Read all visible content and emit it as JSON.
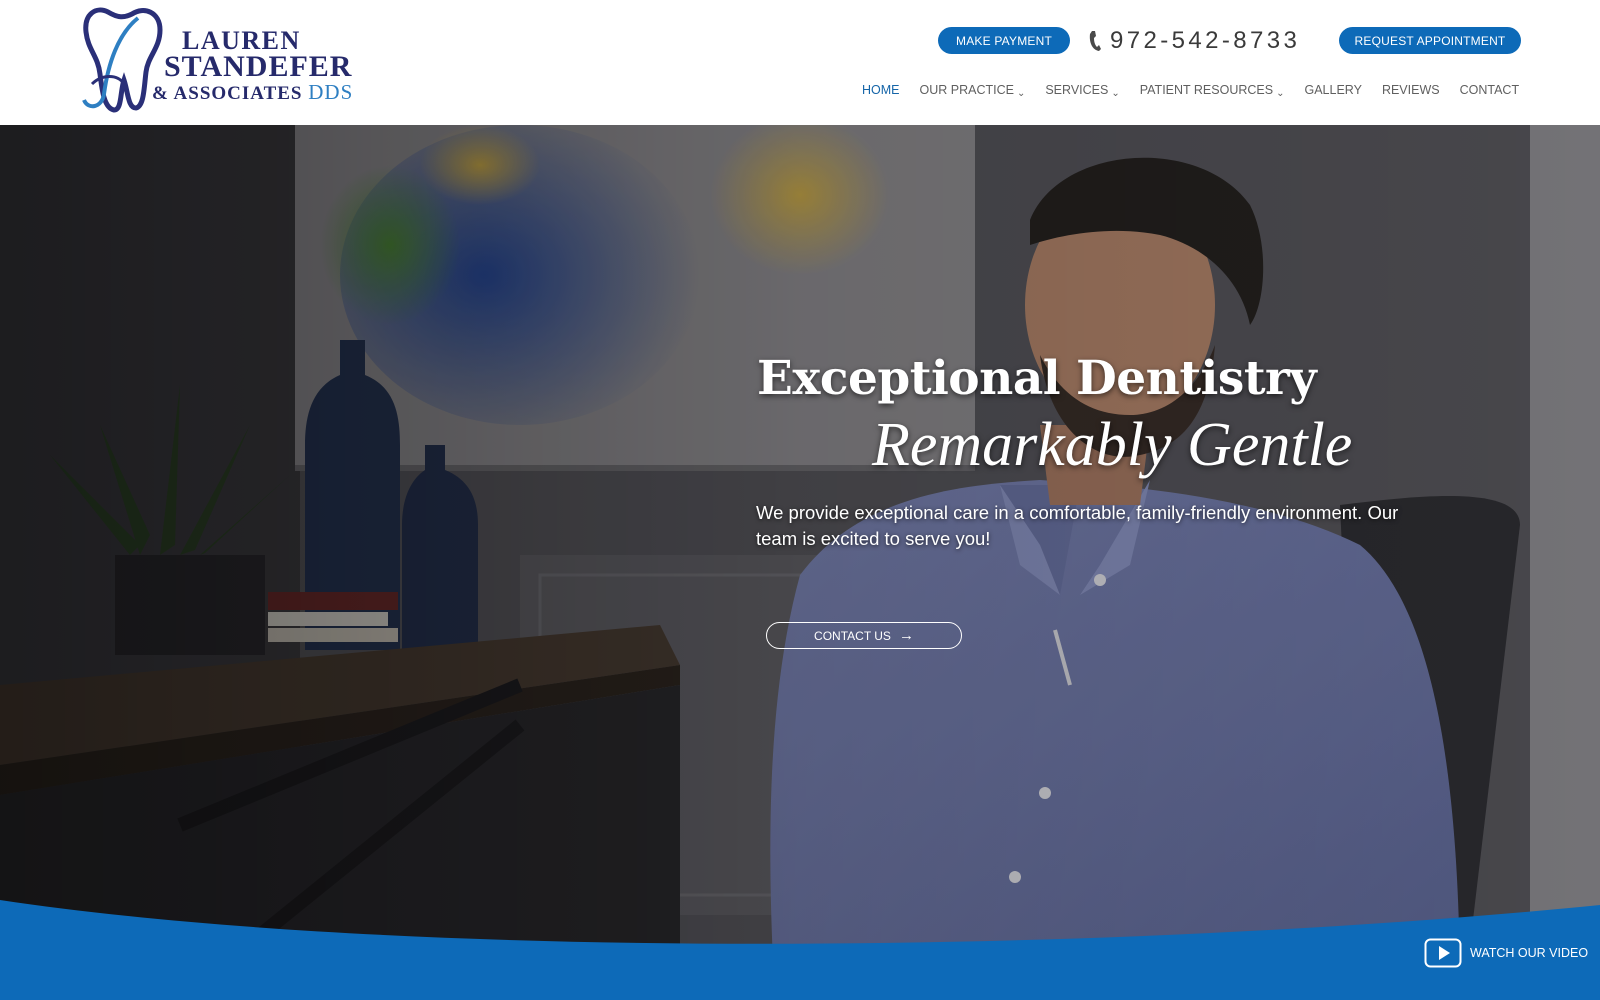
{
  "brand": {
    "line1": "LAUREN",
    "line2": "STANDEFER",
    "line3": "& ASSOCIATES",
    "line3_suffix": "DDS",
    "primary_color": "#262a6b",
    "accent_color": "#0d6ab8"
  },
  "header": {
    "payment_button": "MAKE PAYMENT",
    "phone": "972-542-8733",
    "phone_icon": "phone-icon",
    "appointment_button": "REQUEST APPOINTMENT"
  },
  "nav": {
    "items": [
      {
        "label": "HOME",
        "active": true,
        "dropdown": false
      },
      {
        "label": "OUR PRACTICE",
        "active": false,
        "dropdown": true
      },
      {
        "label": "SERVICES",
        "active": false,
        "dropdown": true
      },
      {
        "label": "PATIENT RESOURCES",
        "active": false,
        "dropdown": true
      },
      {
        "label": "GALLERY",
        "active": false,
        "dropdown": false
      },
      {
        "label": "REVIEWS",
        "active": false,
        "dropdown": false
      },
      {
        "label": "CONTACT",
        "active": false,
        "dropdown": false
      }
    ],
    "chevron_icon": "chevron-down-icon"
  },
  "hero": {
    "title": "Exceptional Dentistry",
    "script": "Remarkably Gentle",
    "subtitle": "We provide exceptional care in a comfortable, family-friendly environment. Our team is excited to serve you!",
    "cta_label": "CONTACT US",
    "cta_icon": "arrow-right-icon",
    "watch_label": "WATCH OUR VIDEO",
    "watch_icon": "play-icon",
    "wave_color": "#0d6ab8"
  }
}
